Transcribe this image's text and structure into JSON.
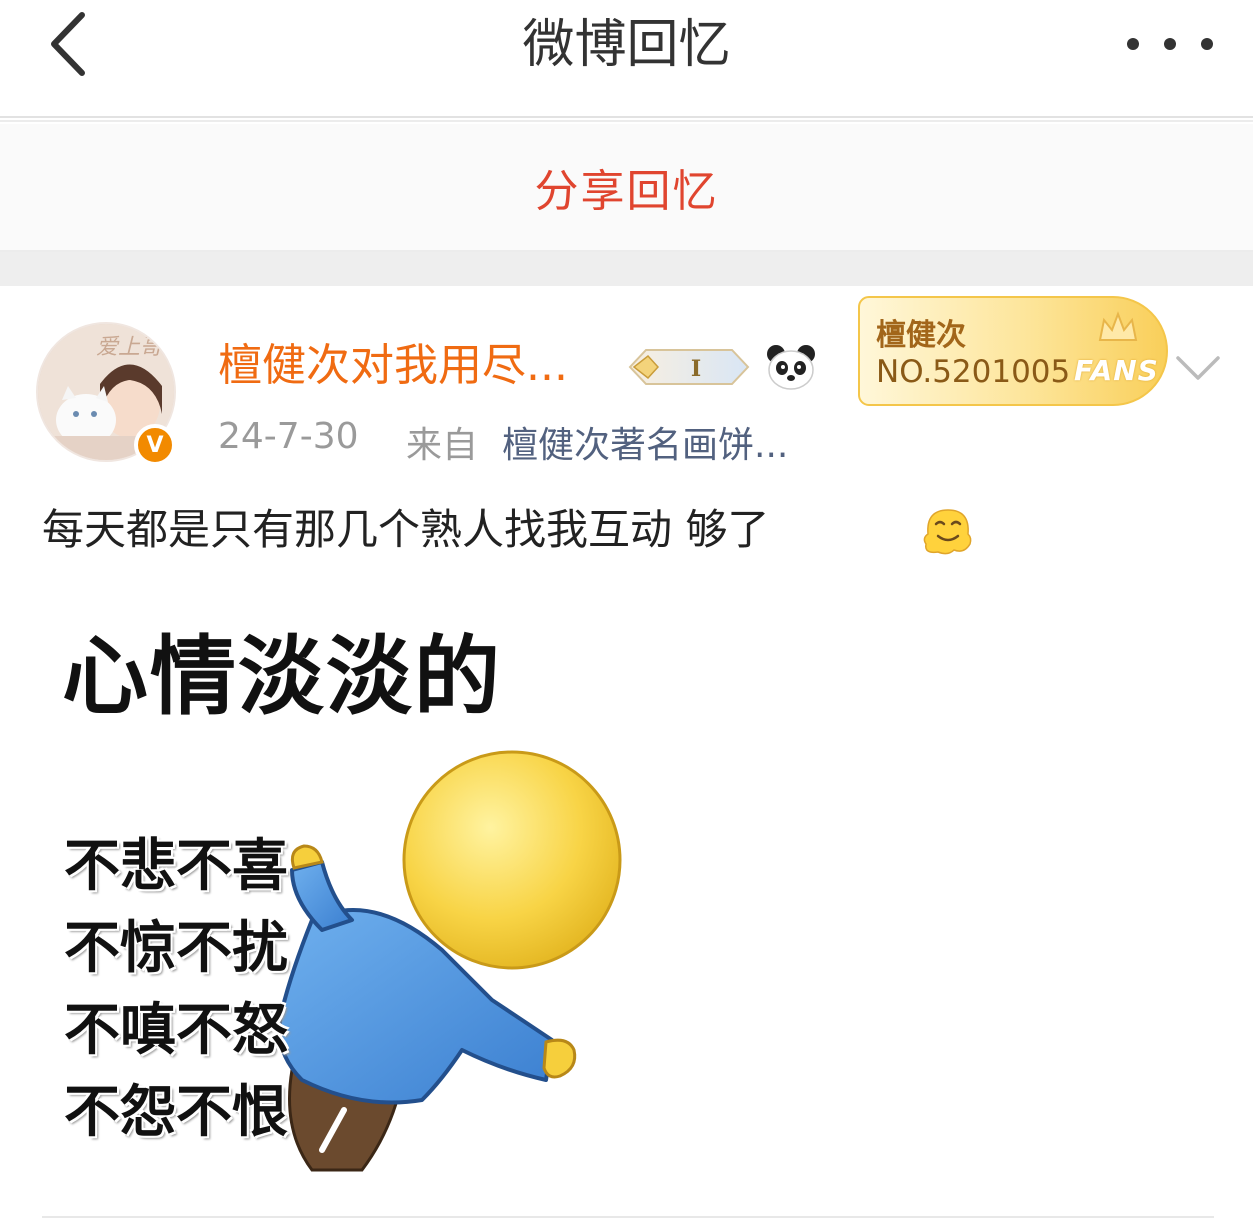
{
  "header": {
    "title": "微博回忆",
    "back_icon": "chevron-left-icon",
    "more_icon": "more-dots-icon"
  },
  "share": {
    "label": "分享回忆",
    "color": "#e0452f"
  },
  "post": {
    "username": "檀健次对我用尽...",
    "username_color": "#f06b12",
    "verified_badge": "V",
    "level_badge_icon": "level-badge-icon",
    "panda_icon": "panda-icon",
    "fans_card": {
      "name": "檀健次",
      "number": "NO.5201005",
      "label": "FANS"
    },
    "date": "24-7-30",
    "from_label": "来自",
    "source": "檀健次著名画饼...",
    "text": "每天都是只有那几个熟人找我互动 够了",
    "emoji_icon": "melting-face-icon",
    "meme": {
      "title": "心情淡淡的",
      "lines": [
        "不悲不喜",
        "不惊不扰",
        "不嗔不怒",
        "不怨不恨"
      ]
    }
  }
}
